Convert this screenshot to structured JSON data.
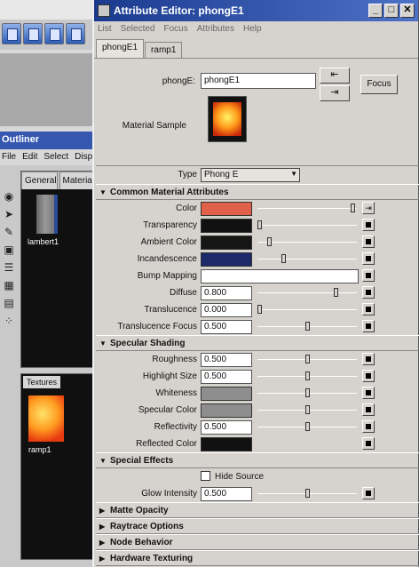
{
  "outliner": {
    "title": "Outliner",
    "menu": [
      "File",
      "Edit",
      "Select",
      "Displ"
    ],
    "mat_tabs": [
      "General",
      "Materia"
    ],
    "lambert_label": "lambert1",
    "textures_tab": "Textures",
    "ramp_label": "ramp1"
  },
  "window": {
    "title": "Attribute Editor: phongE1",
    "menu": [
      "List",
      "Selected",
      "Focus",
      "Attributes",
      "Help"
    ],
    "tabs": [
      "phongE1",
      "ramp1"
    ]
  },
  "node": {
    "label": "phongE:",
    "value": "phongE1",
    "focus_label": "Focus",
    "sample_label": "Material Sample"
  },
  "type": {
    "label": "Type",
    "value": "Phong E"
  },
  "sections": {
    "common": "Common Material Attributes",
    "specular": "Specular Shading",
    "special": "Special Effects",
    "matte": "Matte Opacity",
    "raytrace": "Raytrace Options",
    "node_behavior": "Node Behavior",
    "hardware": "Hardware Texturing"
  },
  "common": {
    "color": "Color",
    "transparency": "Transparency",
    "ambient": "Ambient Color",
    "incandescence": "Incandescence",
    "bump": "Bump Mapping",
    "diffuse": "Diffuse",
    "diffuse_value": "0.800",
    "translucence": "Translucence",
    "translucence_value": "0.000",
    "translucence_focus": "Translucence Focus",
    "translucence_focus_value": "0.500"
  },
  "specular": {
    "roughness": "Roughness",
    "roughness_value": "0.500",
    "highlight": "Highlight Size",
    "highlight_value": "0.500",
    "whiteness": "Whiteness",
    "spec_color": "Specular Color",
    "reflectivity": "Reflectivity",
    "reflectivity_value": "0.500",
    "reflected": "Reflected Color"
  },
  "special": {
    "hide_source": "Hide Source",
    "glow": "Glow Intensity",
    "glow_value": "0.500"
  },
  "colors": {
    "color": "#e0604a",
    "transparency": "#111111",
    "ambient": "#151515",
    "incandescence": "#1c2a6a",
    "whiteness": "#8e8e8e",
    "specular": "#8e8e8e",
    "reflected": "#111111",
    "title_bar": "#1a3a8e"
  },
  "slider_levels": {
    "color": 0.98,
    "transparency": 0.0,
    "ambient": 0.1,
    "incandescence": 0.25,
    "diffuse": 0.8,
    "translucence": 0.0,
    "translucence_focus": 0.5,
    "roughness": 0.5,
    "highlight": 0.5,
    "whiteness": 0.5,
    "spec_color": 0.5,
    "reflectivity": 0.5,
    "glow": 0.5
  }
}
